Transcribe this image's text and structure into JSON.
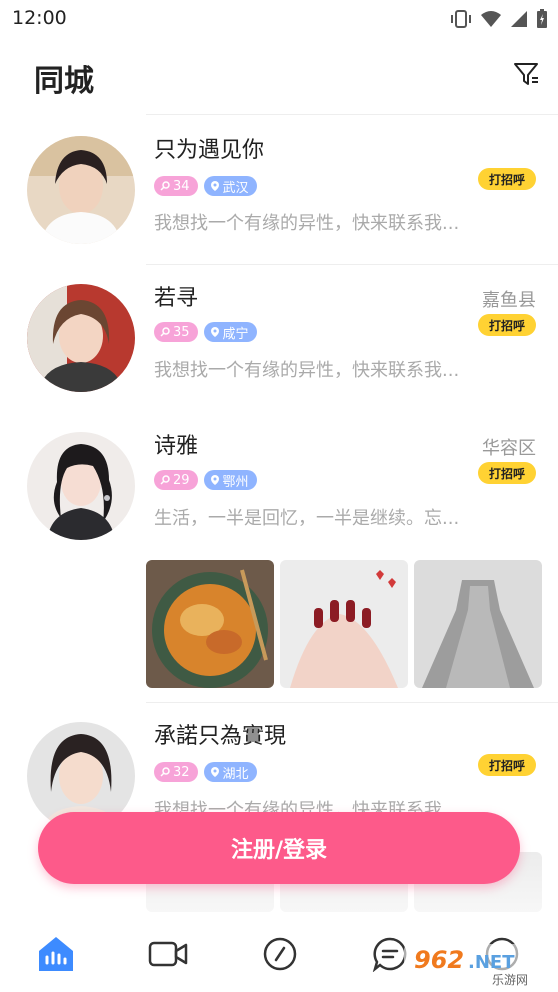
{
  "status_bar": {
    "time": "12:00"
  },
  "header": {
    "title": "同城"
  },
  "feed": [
    {
      "name": "只为遇见你",
      "age": "34",
      "city": "武汉",
      "location": "",
      "bio": "我想找一个有缘的异性，快来联系我...",
      "greet": "打招呼"
    },
    {
      "name": "若寻",
      "age": "35",
      "city": "咸宁",
      "location": "嘉鱼县",
      "bio": "我想找一个有缘的异性，快来联系我...",
      "greet": "打招呼"
    },
    {
      "name": "诗雅",
      "age": "29",
      "city": "鄂州",
      "location": "华容区",
      "bio": "生活，一半是回忆，一半是继续。忘...",
      "greet": "打招呼"
    },
    {
      "name": "承諾只為實現",
      "age": "32",
      "city": "湖北",
      "location": "",
      "bio": "我想找一个有缘的异性，快来联系我...",
      "greet": "打招呼"
    }
  ],
  "login_button": "注册/登录",
  "watermark": {
    "brand": "962.NET",
    "sub": "乐游网"
  },
  "colors": {
    "accent": "#fd5a8a",
    "age_tag": "#f7a3d8",
    "city_tag": "#8fb4ff",
    "greet": "#ffd233",
    "nav_active": "#3d8bff"
  }
}
